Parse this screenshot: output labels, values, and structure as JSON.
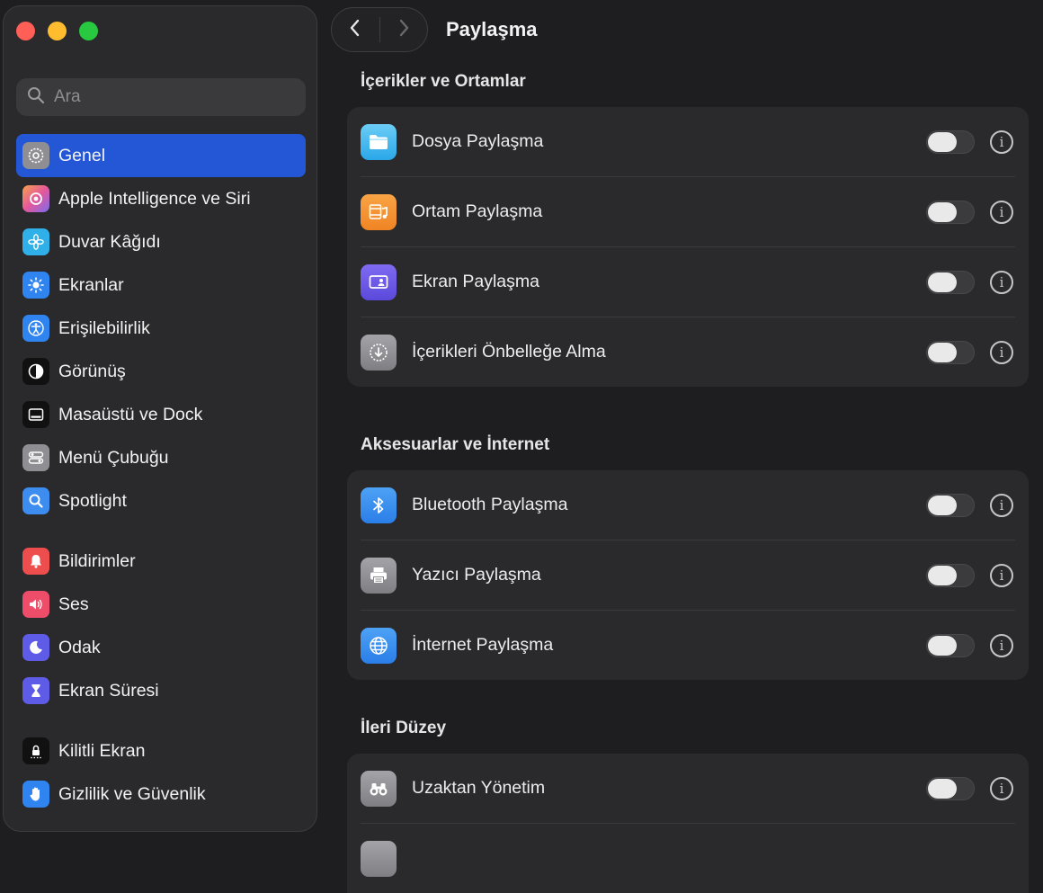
{
  "window": {
    "title": "Paylaşma"
  },
  "search": {
    "placeholder": "Ara"
  },
  "sidebar": {
    "items": [
      {
        "label": "Genel",
        "icon": "gear-icon",
        "active": true
      },
      {
        "label": "Apple Intelligence ve Siri",
        "icon": "siri-icon"
      },
      {
        "label": "Duvar Kâğıdı",
        "icon": "flower-icon"
      },
      {
        "label": "Ekranlar",
        "icon": "sun-icon"
      },
      {
        "label": "Erişilebilirlik",
        "icon": "accessibility-icon"
      },
      {
        "label": "Görünüş",
        "icon": "appearance-icon"
      },
      {
        "label": "Masaüstü ve Dock",
        "icon": "dock-icon"
      },
      {
        "label": "Menü Çubuğu",
        "icon": "menubar-icon"
      },
      {
        "label": "Spotlight",
        "icon": "magnifier-icon"
      },
      {
        "label": "Bildirimler",
        "icon": "bell-icon"
      },
      {
        "label": "Ses",
        "icon": "speaker-icon"
      },
      {
        "label": "Odak",
        "icon": "moon-icon"
      },
      {
        "label": "Ekran Süresi",
        "icon": "hourglass-icon"
      },
      {
        "label": "Kilitli Ekran",
        "icon": "lock-icon"
      },
      {
        "label": "Gizlilik ve Güvenlik",
        "icon": "hand-icon"
      }
    ]
  },
  "sections": [
    {
      "title": "İçerikler ve Ortamlar",
      "rows": [
        {
          "label": "Dosya Paylaşma",
          "icon": "folder-icon",
          "enabled": false
        },
        {
          "label": "Ortam Paylaşma",
          "icon": "media-icon",
          "enabled": false
        },
        {
          "label": "Ekran Paylaşma",
          "icon": "screen-share-icon",
          "enabled": false
        },
        {
          "label": "İçerikleri Önbelleğe Alma",
          "icon": "download-icon",
          "enabled": false
        }
      ]
    },
    {
      "title": "Aksesuarlar ve İnternet",
      "rows": [
        {
          "label": "Bluetooth Paylaşma",
          "icon": "bluetooth-icon",
          "enabled": false
        },
        {
          "label": "Yazıcı Paylaşma",
          "icon": "printer-icon",
          "enabled": false
        },
        {
          "label": "İnternet Paylaşma",
          "icon": "globe-icon",
          "enabled": false
        }
      ]
    },
    {
      "title": "İleri Düzey",
      "rows": [
        {
          "label": "Uzaktan Yönetim",
          "icon": "binoculars-icon",
          "enabled": false
        }
      ]
    }
  ],
  "info_glyph": "i",
  "colors": {
    "accent": "#2357d6",
    "background": "#1e1e20",
    "card": "#2a2a2c"
  }
}
